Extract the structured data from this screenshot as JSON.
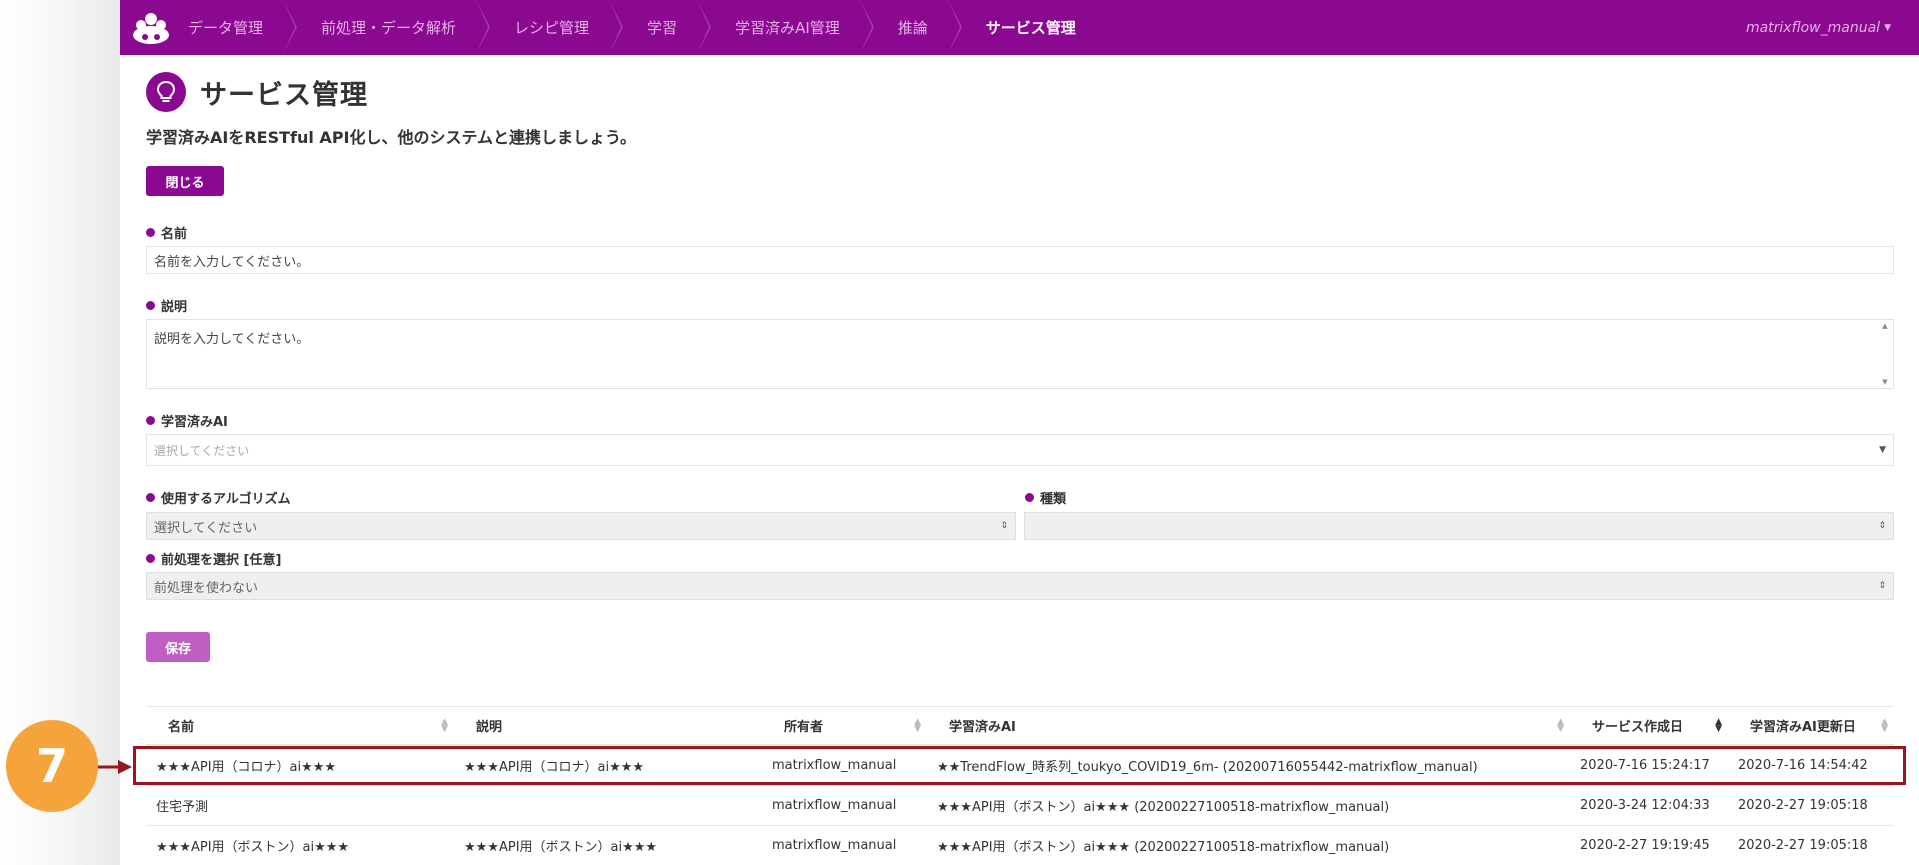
{
  "nav": {
    "breadcrumbs": [
      {
        "label": "データ管理"
      },
      {
        "label": "前処理・データ解析"
      },
      {
        "label": "レシピ管理"
      },
      {
        "label": "学習"
      },
      {
        "label": "学習済みAI管理"
      },
      {
        "label": "推論"
      },
      {
        "label": "サービス管理"
      }
    ],
    "user": "matrixflow_manual"
  },
  "page": {
    "title": "サービス管理",
    "subtitle": "学習済みAIをRESTful API化し、他のシステムと連携しましょう。",
    "close_label": "閉じる",
    "save_label": "保存"
  },
  "form": {
    "name_label": "名前",
    "name_placeholder": "名前を入力してください。",
    "desc_label": "説明",
    "desc_placeholder": "説明を入力してください。",
    "model_label": "学習済みAI",
    "model_placeholder": "選択してください",
    "algo_label": "使用するアルゴリズム",
    "algo_placeholder": "選択してください",
    "type_label": "種類",
    "type_value": "",
    "preprocess_label": "前処理を選択 [任意]",
    "preprocess_value": "前処理を使わない"
  },
  "table": {
    "headers": [
      "名前",
      "説明",
      "所有者",
      "学習済みAI",
      "サービス作成日",
      "学習済みAI更新日"
    ],
    "rows": [
      [
        "★★★API用（コロナ）ai★★★",
        "★★★API用（コロナ）ai★★★",
        "matrixflow_manual",
        "★★TrendFlow_時系列_toukyo_COVID19_6m- (20200716055442-matrixflow_manual)",
        "2020-7-16 15:24:17",
        "2020-7-16 14:54:42"
      ],
      [
        "住宅予測",
        "",
        "matrixflow_manual",
        "★★★API用（ボストン）ai★★★ (20200227100518-matrixflow_manual)",
        "2020-3-24 12:04:33",
        "2020-2-27 19:05:18"
      ],
      [
        "★★★API用（ボストン）ai★★★",
        "★★★API用（ボストン）ai★★★",
        "matrixflow_manual",
        "★★★API用（ボストン）ai★★★ (20200227100518-matrixflow_manual)",
        "2020-2-27 19:19:45",
        "2020-2-27 19:05:18"
      ]
    ]
  },
  "annotation": {
    "step": "7"
  },
  "colors": {
    "brand": "#8b0890",
    "save_button": "#c05ec4",
    "highlight": "#9b1521",
    "step_badge": "#f5a33b"
  }
}
